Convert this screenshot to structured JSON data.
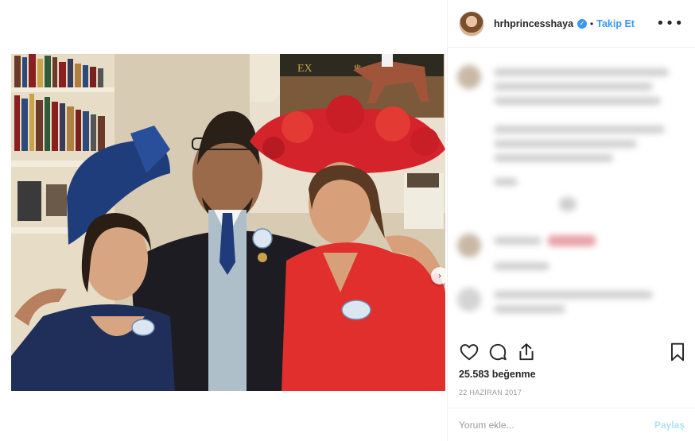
{
  "post": {
    "username": "hrhprincesshaya",
    "follow_label": "Takip Et",
    "separator": "•",
    "more_icon": "more-horizontal-icon",
    "likes": "25.583 beğenme",
    "date": "22 HAZİRAN 2017"
  },
  "comment_form": {
    "placeholder": "Yorum ekle...",
    "submit_label": "Paylaş"
  },
  "carousel": {
    "next_glyph": "›"
  },
  "colors": {
    "accent": "#3897f0",
    "disabled_accent": "#b2dffc",
    "hat_red": "#d4232b",
    "dress_red": "#e02f2c",
    "navy": "#1e3d7a"
  }
}
